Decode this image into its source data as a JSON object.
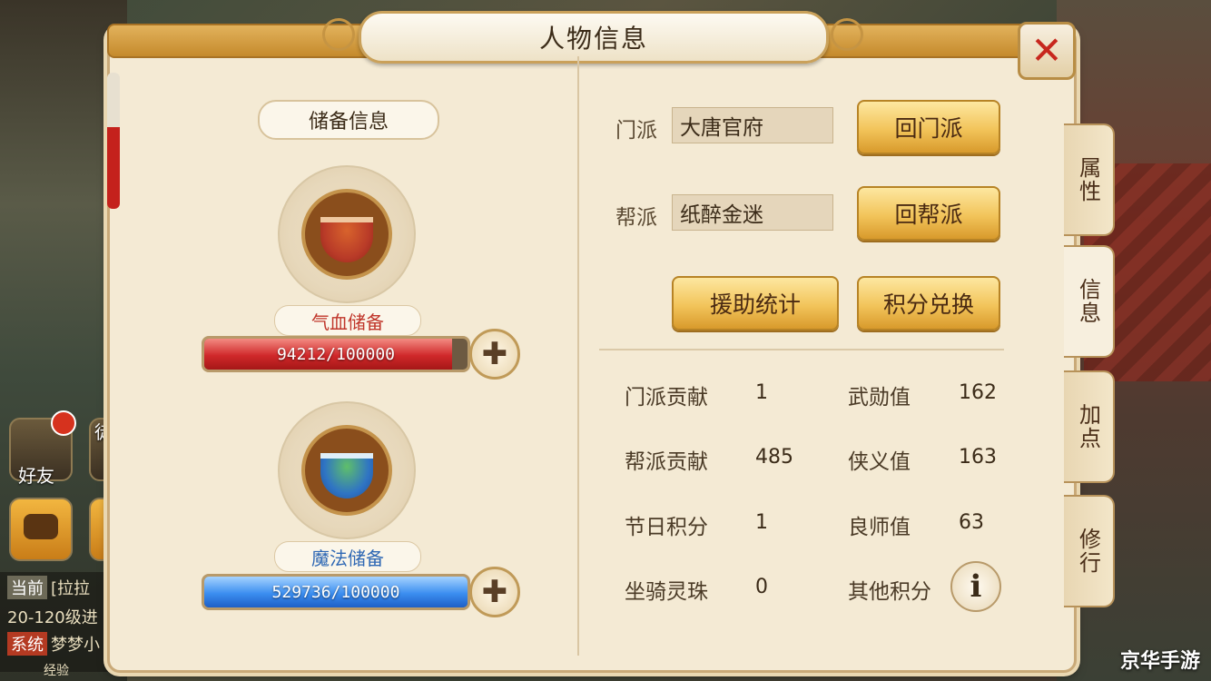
{
  "window": {
    "title": "人物信息",
    "close_icon": "close-icon"
  },
  "left": {
    "section_title": "储备信息",
    "hp_reserve": {
      "label": "气血储备",
      "value_text": "94212/100000",
      "fill_fraction": 0.94,
      "color": "#d0282a",
      "icon": "red-soup-bowl-icon"
    },
    "mp_reserve": {
      "label": "魔法储备",
      "value_text": "529736/100000",
      "fill_fraction": 1.0,
      "color": "#3b8ef0",
      "icon": "blue-soup-bowl-icon"
    },
    "plus_icon": "plus-icon"
  },
  "right": {
    "sect": {
      "label": "门派",
      "value": "大唐官府",
      "button": "回门派"
    },
    "guild": {
      "label": "帮派",
      "value": "纸醉金迷",
      "button": "回帮派"
    },
    "buttons": {
      "assist_stats": "援助统计",
      "points_exchange": "积分兑换"
    },
    "stats": [
      {
        "label": "门派贡献",
        "value": "1"
      },
      {
        "label": "武勋值",
        "value": "162"
      },
      {
        "label": "帮派贡献",
        "value": "485"
      },
      {
        "label": "侠义值",
        "value": "163"
      },
      {
        "label": "节日积分",
        "value": "1"
      },
      {
        "label": "良师值",
        "value": "63"
      },
      {
        "label": "坐骑灵珠",
        "value": "0"
      },
      {
        "label": "其他积分",
        "value": ""
      }
    ],
    "info_icon": "info-icon"
  },
  "side_tabs": [
    "属性",
    "信息",
    "加点",
    "修行"
  ],
  "active_tab": "信息",
  "hud": {
    "friends_label": "好友",
    "apprentice_label": "徒",
    "chat_lines": [
      {
        "tag": "当前",
        "text": "[拉拉"
      },
      {
        "tag": "",
        "text": "20-120级进"
      },
      {
        "tag": "系统",
        "text": "梦梦小"
      }
    ],
    "exp_label": "经验"
  },
  "watermark": "京华手游",
  "colors": {
    "panel_bg": "#f4ead4",
    "gold_button": "#f2c45a",
    "close_red": "#c7271e"
  }
}
